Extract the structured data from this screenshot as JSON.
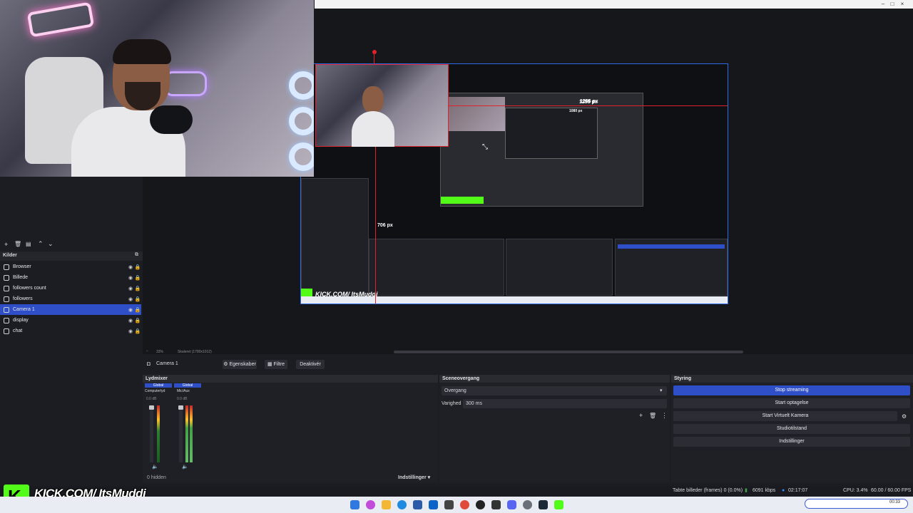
{
  "window": {
    "minimize": "–",
    "maximize": "□",
    "close": "×"
  },
  "preview": {
    "guide_horizontal": "1255 px",
    "guide_vertical": "706 px",
    "nested_guide": "1255 px",
    "nested_guide_2": "1080 px",
    "kick_overlay": "KICK.COM/   ItsMuddi"
  },
  "sources": {
    "header": "Kilder",
    "items": [
      {
        "label": "Browser",
        "selected": false
      },
      {
        "label": "Billede",
        "selected": false
      },
      {
        "label": "followers count",
        "selected": false
      },
      {
        "label": "followers",
        "selected": false
      },
      {
        "label": "Camera 1",
        "selected": true
      },
      {
        "label": "display",
        "selected": false
      },
      {
        "label": "chat",
        "selected": false
      }
    ]
  },
  "zoom": {
    "level": "33%",
    "scale_label": "Skaleret (1780x1012)"
  },
  "source_bar": {
    "name": "Camera 1",
    "properties": "Egenskaber",
    "filters": "Filtre",
    "deactivate": "Deaktivér"
  },
  "audio_mixer": {
    "title": "Lydmixer",
    "channels": [
      {
        "scope": "Global",
        "name": "Computerlyd",
        "db": "0.0 dB"
      },
      {
        "scope": "Global",
        "name": "Mic/Aux",
        "db": "0.0 dB"
      }
    ],
    "scale": [
      "0",
      "-6",
      "-12",
      "-18",
      "-24",
      "-30",
      "-36",
      "-42",
      "-48",
      "-54",
      "-60"
    ],
    "hidden": "0 hidden",
    "settings": "Indstillinger"
  },
  "transitions": {
    "title": "Sceneovergang",
    "transition": "Overgang",
    "duration_label": "Varighed",
    "duration_value": "300 ms"
  },
  "controls": {
    "title": "Styring",
    "buttons": [
      {
        "label": "Stop streaming",
        "active": true
      },
      {
        "label": "Start optagelse",
        "active": false
      },
      {
        "label": "Start Virtuelt Kamera",
        "active": false
      },
      {
        "label": "Studiotilstand",
        "active": false
      },
      {
        "label": "Indstillinger",
        "active": false
      }
    ]
  },
  "status": {
    "frames": "Tabte billeder (frames) 0 (0.0%)",
    "bitrate": "6091 kbps",
    "time": "02:17:07",
    "cpu": "CPU: 3.4%",
    "fps": "60.00 / 60.00 FPS"
  },
  "kick_banner": "KICK.COM/   ItsMuddi",
  "taskbar": {
    "clock": "00:33"
  },
  "colors": {
    "accent": "#2f4fc9",
    "kick_green": "#53fc18",
    "guide_red": "#e0222a"
  }
}
